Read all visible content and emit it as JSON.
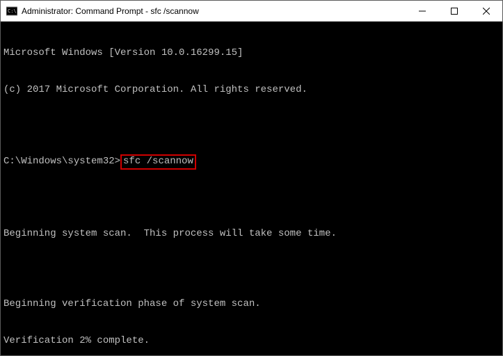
{
  "window": {
    "title": "Administrator: Command Prompt - sfc  /scannow"
  },
  "terminal": {
    "line1": "Microsoft Windows [Version 10.0.16299.15]",
    "line2": "(c) 2017 Microsoft Corporation. All rights reserved.",
    "prompt": "C:\\Windows\\system32>",
    "command": "sfc /scannow",
    "line3": "Beginning system scan.  This process will take some time.",
    "line4": "Beginning verification phase of system scan.",
    "line5": "Verification 2% complete."
  }
}
